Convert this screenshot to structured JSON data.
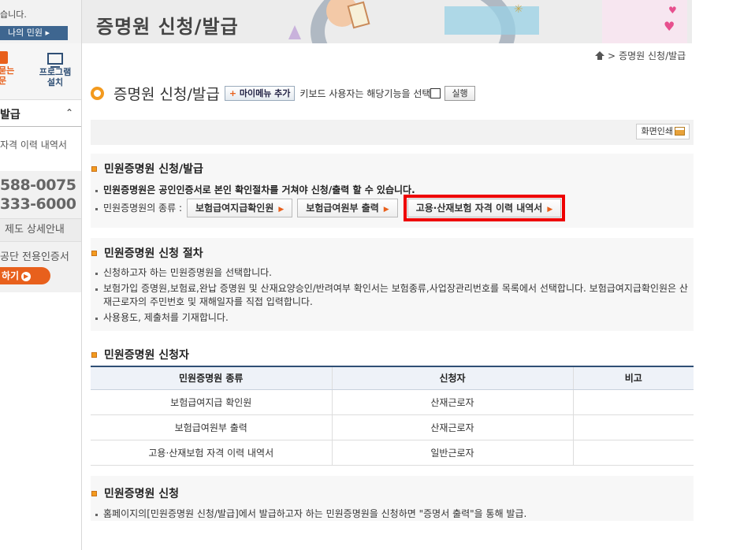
{
  "sidebar": {
    "greeting": "습니다.",
    "my_minwon": "나의 민원 ▸",
    "faq": "묻는\n문",
    "program": "프로그램\n설치",
    "menu_title": "발급",
    "sub_item": "자격 이력 내역서",
    "call_line1": "588-0075",
    "call_line2": "333-6000",
    "guide": "제도 상세안내",
    "cert_text": "공단 전용인증서",
    "cert_button": "하기"
  },
  "banner": {
    "title": "증명원 신청/발급"
  },
  "breadcrumb": {
    "current": "증명원 신청/발급"
  },
  "header": {
    "title": "증명원 신청/발급",
    "mymenu_add": "마이메뉴 추가",
    "keyboard_label": "키보드 사용자는 해당기능을 선택",
    "run_button": "실행",
    "print_button": "화면인쇄"
  },
  "section1": {
    "heading": "민원증명원 신청/발급",
    "note": "민원증명원은 공인인증서로 본인 확인절차를 거쳐야 신청/출력 할 수 있습니다.",
    "types_label": "민원증명원의 종류 :",
    "types": [
      "보험급여지급확인원",
      "보험급여원부 출력",
      "고용·산재보험 자격 이력 내역서"
    ]
  },
  "section2": {
    "heading": "민원증명원 신청 절차",
    "items": [
      "신청하고자 하는 민원증명원을 선택합니다.",
      "보험가입 증명원,보험료,완납 증명원 및 산재요양승인/반려여부 확인서는 보험종류,사업장관리번호를 목록에서 선택합니다. 보험급여지급확인원은 산재근로자의 주민번호 및 재해일자를 직접 입력합니다.",
      "사용용도, 제출처를 기재합니다."
    ]
  },
  "section3": {
    "heading": "민원증명원 신청자",
    "columns": [
      "민원증명원 종류",
      "신청자",
      "비고"
    ],
    "rows": [
      [
        "보험급여지급 확인원",
        "산재근로자",
        ""
      ],
      [
        "보험급여원부 출력",
        "산재근로자",
        ""
      ],
      [
        "고용·산재보험 자격 이력 내역서",
        "일반근로자",
        ""
      ]
    ]
  },
  "section4": {
    "heading": "민원증명원 신청",
    "note": "홈페이지의[민원증명원 신청/발급]에서 발급하고자 하는 민원증명원을 신청하면 \"증명서 출력\"을 통해 발급."
  },
  "colors": {
    "accent": "#f39a1e",
    "highlight": "#ee0000",
    "nav": "#2f4f75"
  }
}
